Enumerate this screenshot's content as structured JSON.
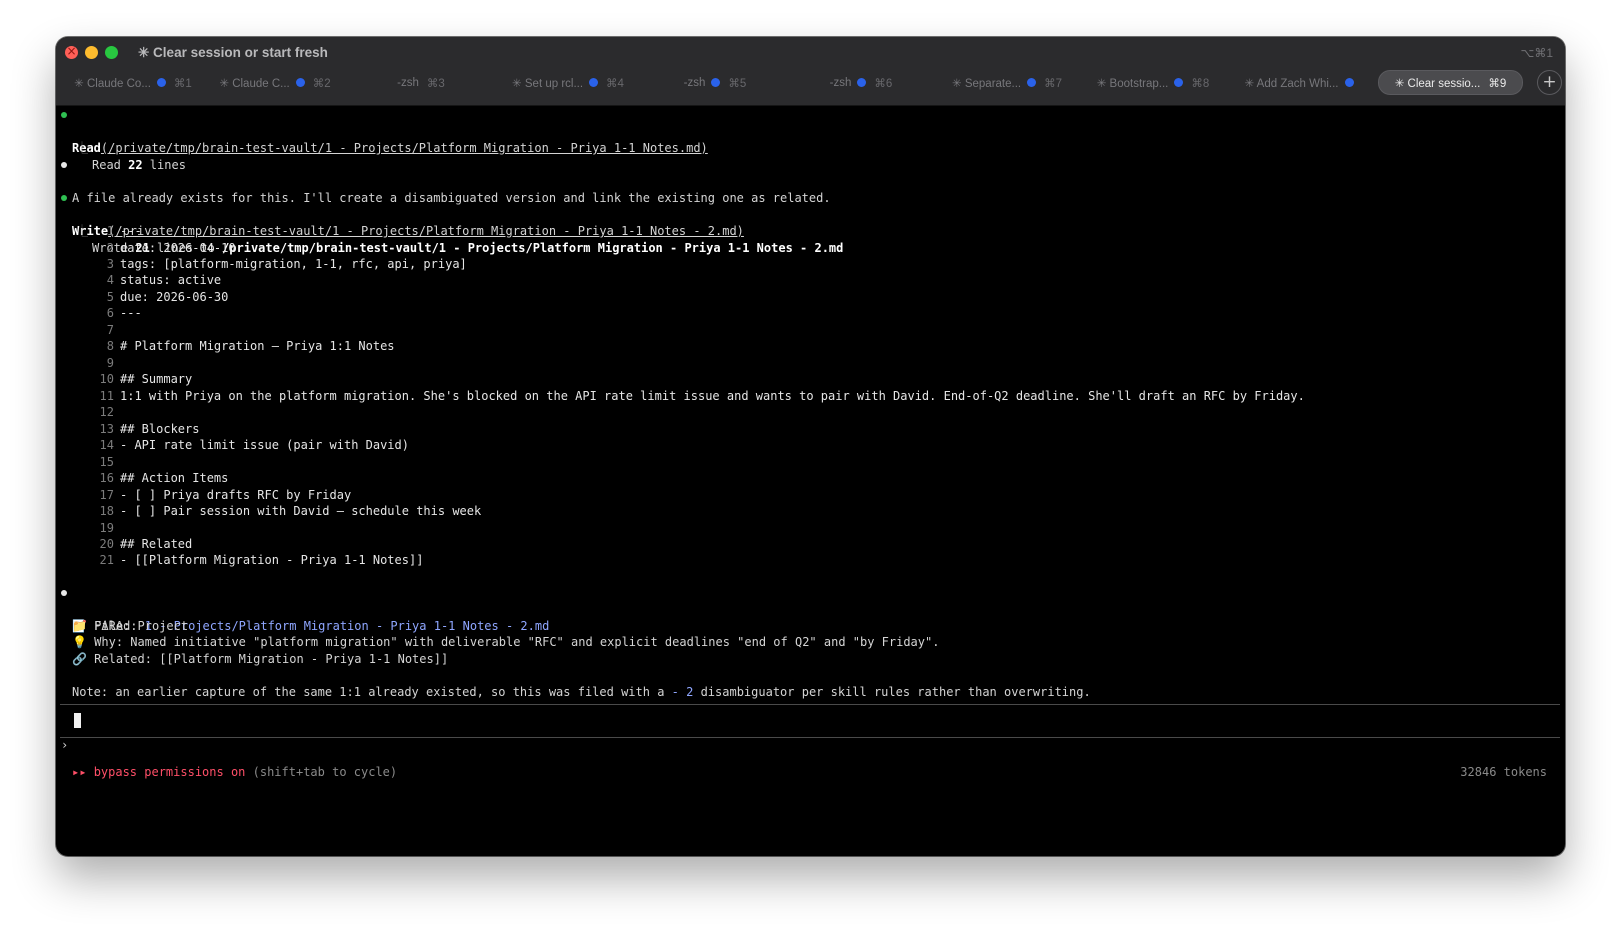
{
  "window": {
    "title": "✳ Clear session or start fresh",
    "shortcut": "⌥⌘1"
  },
  "tabs": [
    {
      "label": "✳ Claude Co...",
      "dot": true,
      "shortcut": "⌘1"
    },
    {
      "label": "✳ Claude C...",
      "dot": true,
      "shortcut": "⌘2"
    },
    {
      "label": "-zsh",
      "dot": false,
      "shortcut": "⌘3"
    },
    {
      "label": "✳ Set up rcl...",
      "dot": true,
      "shortcut": "⌘4"
    },
    {
      "label": "-zsh",
      "dot": true,
      "shortcut": "⌘5"
    },
    {
      "label": "-zsh",
      "dot": true,
      "shortcut": "⌘6"
    },
    {
      "label": "✳ Separate...",
      "dot": true,
      "shortcut": "⌘7"
    },
    {
      "label": "✳ Bootstrap...",
      "dot": true,
      "shortcut": "⌘8"
    },
    {
      "label": "✳ Add Zach Whi...",
      "dot": true,
      "shortcut": ""
    },
    {
      "label": "✳ Clear sessio...",
      "dot": false,
      "shortcut": "⌘9",
      "active": true
    }
  ],
  "plus_label": "+",
  "read": {
    "tool": "Read",
    "path": "(/private/tmp/brain-test-vault/1 - Projects/Platform Migration - Priya 1-1 Notes.md)",
    "result_prefix": "Read ",
    "result_count": "22",
    "result_suffix": " lines"
  },
  "message1": "A file already exists for this. I'll create a disambiguated version and link the existing one as related.",
  "write": {
    "tool": "Write",
    "path": "(/private/tmp/brain-test-vault/1 - Projects/Platform Migration - Priya 1-1 Notes - 2.md)",
    "result_prefix": "Wrote ",
    "result_count": "21",
    "result_mid": " lines to ",
    "result_path": "/private/tmp/brain-test-vault/1 - Projects/Platform Migration - Priya 1-1 Notes - 2.md"
  },
  "code_lines": [
    {
      "n": "1",
      "t": "---"
    },
    {
      "n": "2",
      "t": "date: 2026-04-10"
    },
    {
      "n": "3",
      "t": "tags: [platform-migration, 1-1, rfc, api, priya]"
    },
    {
      "n": "4",
      "t": "status: active"
    },
    {
      "n": "5",
      "t": "due: 2026-06-30"
    },
    {
      "n": "6",
      "t": "---"
    },
    {
      "n": "7",
      "t": ""
    },
    {
      "n": "8",
      "t": "# Platform Migration – Priya 1:1 Notes"
    },
    {
      "n": "9",
      "t": ""
    },
    {
      "n": "10",
      "t": "## Summary"
    },
    {
      "n": "11",
      "t": "1:1 with Priya on the platform migration. She's blocked on the API rate limit issue and wants to pair with David. End-of-Q2 deadline. She'll draft an RFC by Friday."
    },
    {
      "n": "12",
      "t": ""
    },
    {
      "n": "13",
      "t": "## Blockers"
    },
    {
      "n": "14",
      "t": "- API rate limit issue (pair with David)"
    },
    {
      "n": "15",
      "t": ""
    },
    {
      "n": "16",
      "t": "## Action Items"
    },
    {
      "n": "17",
      "t": "- [ ] Priya drafts RFC by Friday"
    },
    {
      "n": "18",
      "t": "- [ ] Pair session with David – schedule this week"
    },
    {
      "n": "19",
      "t": ""
    },
    {
      "n": "20",
      "t": "## Related"
    },
    {
      "n": "21",
      "t": "- [[Platform Migration - Priya 1-1 Notes]]"
    }
  ],
  "summary": {
    "filed_icon": "📝",
    "filed_label": " Filed: ",
    "filed_path": "1 - Projects/Platform Migration - Priya 1-1 Notes - 2.md",
    "para_icon": "📁",
    "para_text": " PARA: Project",
    "why_icon": "💡",
    "why_text": " Why: Named initiative \"platform migration\" with deliverable \"RFC\" and explicit deadlines \"end of Q2\" and \"by Friday\".",
    "related_icon": "🔗",
    "related_text": " Related: [[Platform Migration - Priya 1-1 Notes]]",
    "note_prefix": "Note: an earlier capture of the same 1:1 already existed, so this was filed with a ",
    "note_highlight": "- 2",
    "note_suffix": " disambiguator per skill rules rather than overwriting."
  },
  "prompt": {
    "symbol": "›"
  },
  "status": {
    "arrows": "▸▸",
    "mode": "bypass permissions on",
    "hint": " (shift+tab to cycle)",
    "tokens": "32846 tokens"
  },
  "colors": {
    "accent_blue": "#2a62ea",
    "bullet_green": "#2fc052",
    "bypass_red": "#ff4f68",
    "link_blue": "#8fa6ff"
  }
}
